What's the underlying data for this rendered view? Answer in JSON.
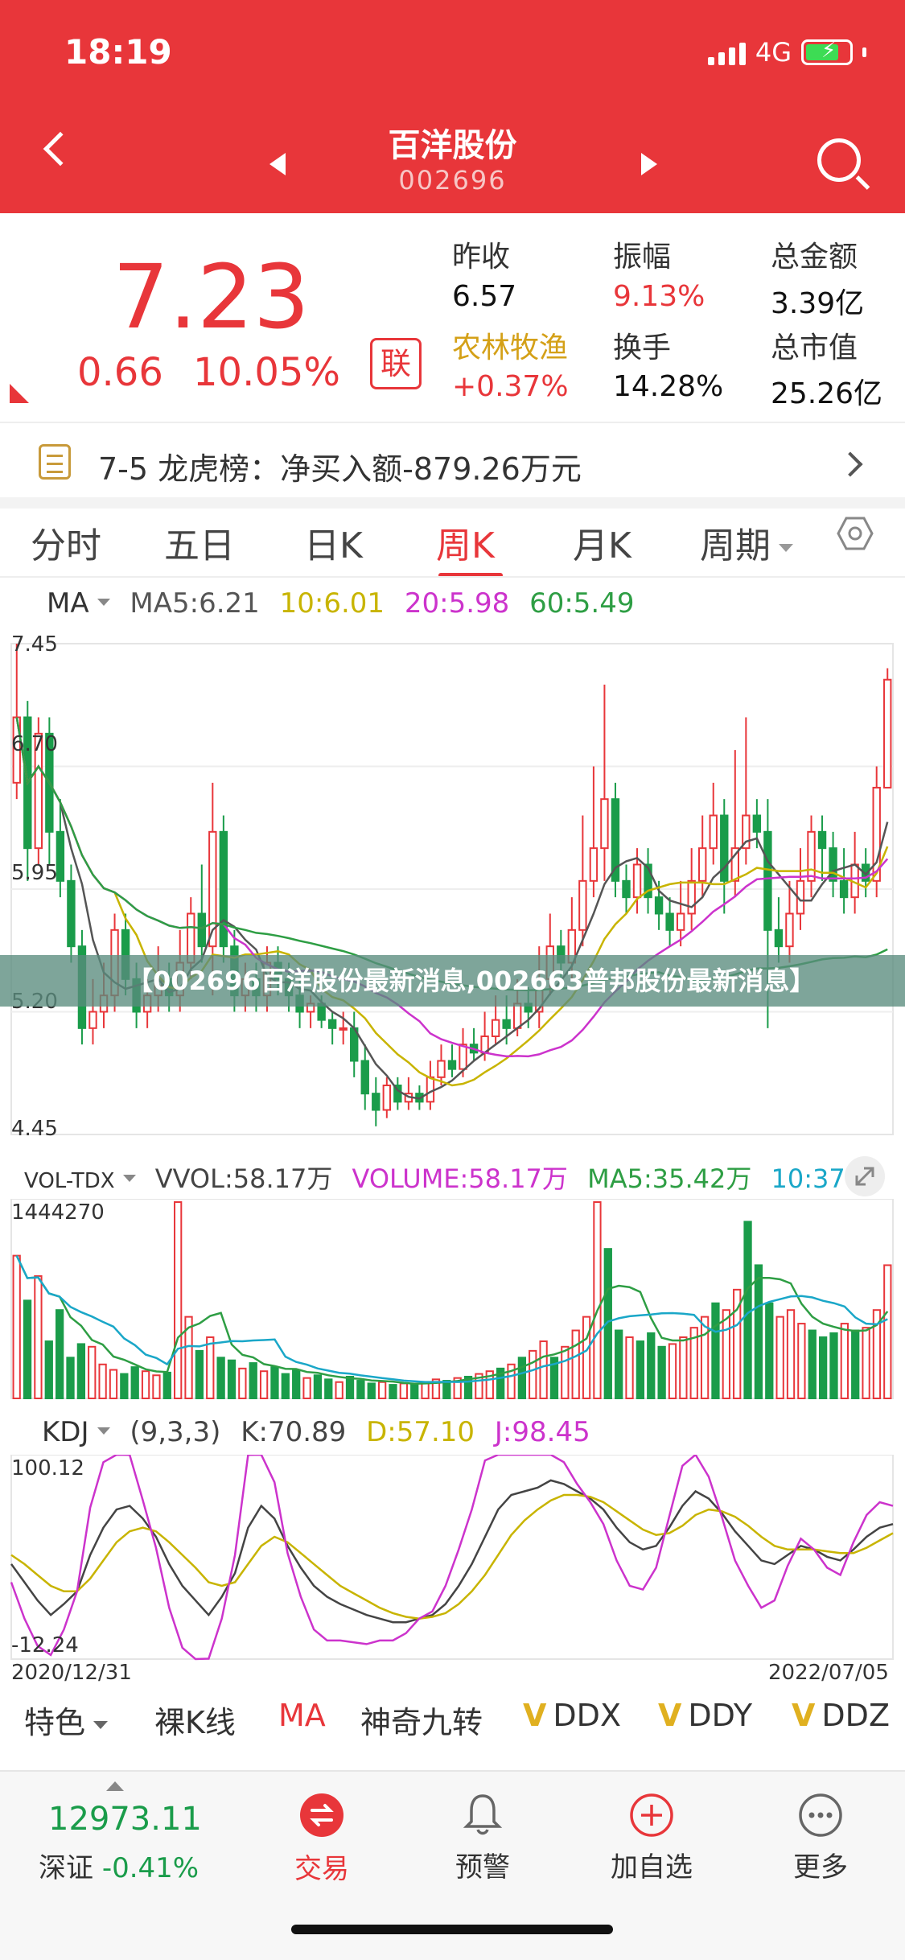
{
  "status": {
    "time": "18:19",
    "network": "4G"
  },
  "header": {
    "name": "百洋股份",
    "code": "002696"
  },
  "quote": {
    "price": "7.23",
    "change": "0.66",
    "change_pct": "10.05%",
    "badge": "联",
    "cells": [
      {
        "label": "昨收",
        "value": "6.57"
      },
      {
        "label": "振幅",
        "value": "9.13%"
      },
      {
        "label": "总金额",
        "value": "3.39亿"
      },
      {
        "label": "农林牧渔",
        "value": "+0.37%"
      },
      {
        "label": "换手",
        "value": "14.28%"
      },
      {
        "label": "总市值",
        "value": "25.26亿"
      }
    ]
  },
  "lhb": {
    "text": "7-5 龙虎榜：净买入额-879.26万元"
  },
  "tabs": [
    "分时",
    "五日",
    "日K",
    "周K",
    "月K",
    "周期"
  ],
  "active_tab": "周K",
  "ma_row": {
    "name": "MA",
    "ma5": "MA5:6.21",
    "ma10": "10:6.01",
    "ma20": "20:5.98",
    "ma60": "60:5.49"
  },
  "price_axis": {
    "top": "7.45",
    "l2": "6.70",
    "l3": "5.95",
    "l4": "5.20",
    "bottom": "4.45"
  },
  "vol_row": {
    "name": "VOL-TDX",
    "vvol": "VVOL:58.17万",
    "volume": "VOLUME:58.17万",
    "ma5": "MA5:35.42万",
    "ma10": "10:37..."
  },
  "vol_axis": {
    "top": "1444270"
  },
  "kdj_row": {
    "name": "KDJ",
    "params": "(9,3,3)",
    "k": "K:70.89",
    "d": "D:57.10",
    "j": "J:98.45"
  },
  "kdj_axis": {
    "top": "100.12",
    "bottom": "-12.24"
  },
  "date_range": {
    "start": "2020/12/31",
    "end": "2022/07/05"
  },
  "watermark": "【002696百洋股份最新消息,002663普邦股份最新消息】",
  "tools": {
    "special": "特色",
    "naked": "裸K线",
    "ma": "MA",
    "shenqi": "神奇九转",
    "ddx": "DDX",
    "ddy": "DDY",
    "ddz": "DDZ",
    "v": "V"
  },
  "tabbar": {
    "index_value": "12973.11",
    "index_name": "深证",
    "index_change": "-0.41%",
    "items": [
      "交易",
      "预警",
      "加自选",
      "更多"
    ]
  },
  "colors": {
    "brand_red": "#e8363a",
    "down_green": "#1a9c4a",
    "ma10": "#c8b400",
    "ma20": "#cc33cc",
    "ma60": "#2e9e44"
  },
  "chart_data": [
    {
      "type": "candlestick",
      "title": "",
      "period": "weekly",
      "ylim": [
        4.45,
        7.45
      ],
      "x_range": [
        "2020/12/31",
        "2022/07/05"
      ],
      "indicators": {
        "MA5": 6.21,
        "MA10": 6.01,
        "MA20": 5.98,
        "MA60": 5.49
      },
      "candles": [
        [
          6.6,
          7.0,
          7.45,
          6.5
        ],
        [
          7.0,
          6.2,
          7.1,
          6.0
        ],
        [
          6.2,
          6.9,
          7.0,
          6.1
        ],
        [
          6.9,
          6.3,
          7.0,
          6.1
        ],
        [
          6.3,
          6.0,
          6.5,
          5.9
        ],
        [
          6.0,
          5.6,
          6.1,
          5.5
        ],
        [
          5.6,
          5.1,
          5.7,
          5.0
        ],
        [
          5.1,
          5.2,
          5.4,
          5.0
        ],
        [
          5.2,
          5.3,
          5.5,
          5.1
        ],
        [
          5.3,
          5.7,
          5.8,
          5.2
        ],
        [
          5.7,
          5.4,
          5.8,
          5.3
        ],
        [
          5.4,
          5.2,
          5.5,
          5.1
        ],
        [
          5.2,
          5.3,
          5.4,
          5.1
        ],
        [
          5.3,
          5.4,
          5.6,
          5.2
        ],
        [
          5.4,
          5.3,
          5.5,
          5.2
        ],
        [
          5.3,
          5.5,
          5.7,
          5.2
        ],
        [
          5.5,
          5.8,
          5.9,
          5.4
        ],
        [
          5.8,
          5.6,
          6.1,
          5.5
        ],
        [
          5.6,
          6.3,
          6.6,
          5.3
        ],
        [
          6.3,
          5.6,
          6.4,
          5.5
        ],
        [
          5.6,
          5.3,
          5.7,
          5.2
        ],
        [
          5.3,
          5.4,
          5.5,
          5.2
        ],
        [
          5.4,
          5.3,
          5.5,
          5.2
        ],
        [
          5.3,
          5.5,
          5.6,
          5.2
        ],
        [
          5.5,
          5.4,
          5.6,
          5.3
        ],
        [
          5.4,
          5.3,
          5.5,
          5.2
        ],
        [
          5.3,
          5.2,
          5.4,
          5.1
        ],
        [
          5.2,
          5.25,
          5.3,
          5.1
        ],
        [
          5.25,
          5.15,
          5.3,
          5.1
        ],
        [
          5.15,
          5.1,
          5.2,
          5.0
        ],
        [
          5.1,
          5.1,
          5.2,
          5.0
        ],
        [
          5.1,
          4.9,
          5.2,
          4.8
        ],
        [
          4.9,
          4.7,
          5.0,
          4.6
        ],
        [
          4.7,
          4.6,
          4.8,
          4.5
        ],
        [
          4.6,
          4.75,
          4.8,
          4.55
        ],
        [
          4.75,
          4.65,
          4.8,
          4.6
        ],
        [
          4.65,
          4.7,
          4.8,
          4.6
        ],
        [
          4.7,
          4.65,
          4.75,
          4.6
        ],
        [
          4.65,
          4.8,
          4.9,
          4.6
        ],
        [
          4.8,
          4.9,
          5.0,
          4.75
        ],
        [
          4.9,
          4.85,
          5.0,
          4.8
        ],
        [
          4.85,
          5.0,
          5.1,
          4.8
        ],
        [
          5.0,
          4.95,
          5.1,
          4.9
        ],
        [
          4.95,
          5.05,
          5.2,
          4.9
        ],
        [
          5.05,
          5.15,
          5.3,
          5.0
        ],
        [
          5.15,
          5.1,
          5.3,
          5.0
        ],
        [
          5.1,
          5.25,
          5.4,
          5.05
        ],
        [
          5.25,
          5.2,
          5.35,
          5.1
        ],
        [
          5.2,
          5.4,
          5.6,
          5.1
        ],
        [
          5.4,
          5.6,
          5.8,
          5.3
        ],
        [
          5.6,
          5.5,
          5.7,
          5.4
        ],
        [
          5.5,
          5.7,
          5.9,
          5.4
        ],
        [
          5.7,
          6.0,
          6.4,
          5.6
        ],
        [
          6.0,
          6.2,
          6.7,
          5.9
        ],
        [
          6.2,
          6.5,
          7.2,
          6.0
        ],
        [
          6.5,
          6.0,
          6.6,
          5.9
        ],
        [
          6.0,
          5.9,
          6.1,
          5.8
        ],
        [
          5.9,
          6.1,
          6.2,
          5.8
        ],
        [
          6.1,
          5.9,
          6.2,
          5.8
        ],
        [
          5.9,
          5.8,
          6.0,
          5.7
        ],
        [
          5.8,
          5.7,
          5.9,
          5.6
        ],
        [
          5.7,
          5.8,
          6.0,
          5.6
        ],
        [
          5.8,
          6.0,
          6.2,
          5.7
        ],
        [
          6.0,
          6.2,
          6.4,
          5.9
        ],
        [
          6.2,
          6.4,
          6.6,
          6.1
        ],
        [
          6.4,
          6.0,
          6.5,
          5.8
        ],
        [
          6.0,
          6.2,
          6.8,
          5.9
        ],
        [
          6.2,
          6.4,
          7.0,
          6.1
        ],
        [
          6.4,
          6.3,
          6.5,
          6.2
        ],
        [
          6.3,
          5.7,
          6.5,
          5.1
        ],
        [
          5.7,
          5.6,
          5.9,
          5.5
        ],
        [
          5.6,
          5.8,
          6.0,
          5.5
        ],
        [
          5.8,
          6.0,
          6.2,
          5.7
        ],
        [
          6.0,
          6.3,
          6.4,
          5.9
        ],
        [
          6.3,
          6.2,
          6.4,
          6.0
        ],
        [
          6.2,
          6.0,
          6.3,
          5.9
        ],
        [
          6.0,
          5.9,
          6.2,
          5.8
        ],
        [
          5.9,
          6.1,
          6.3,
          5.8
        ],
        [
          6.1,
          6.0,
          6.2,
          5.9
        ],
        [
          6.0,
          6.57,
          6.7,
          5.9
        ],
        [
          6.57,
          7.23,
          7.3,
          6.57
        ]
      ]
    },
    {
      "type": "bar",
      "title": "",
      "ylim": [
        0,
        1444270
      ],
      "series": [
        {
          "name": "VVOL",
          "values": [
            1050000,
            720000,
            900000,
            420000,
            650000,
            300000,
            400000,
            380000,
            250000,
            210000,
            180000,
            230000,
            200000,
            170000,
            190000,
            1444270,
            600000,
            350000,
            450000,
            300000,
            280000,
            220000,
            260000,
            200000,
            230000,
            180000,
            210000,
            150000,
            170000,
            140000,
            120000,
            160000,
            130000,
            110000,
            120000,
            100000,
            110000,
            100000,
            120000,
            140000,
            130000,
            150000,
            160000,
            180000,
            200000,
            220000,
            250000,
            300000,
            350000,
            420000,
            300000,
            380000,
            500000,
            600000,
            1444270,
            1100000,
            500000,
            450000,
            420000,
            480000,
            380000,
            400000,
            450000,
            520000,
            600000,
            700000,
            650000,
            800000,
            1300000,
            980000,
            700000,
            600000,
            650000,
            550000,
            500000,
            450000,
            480000,
            550000,
            500000,
            520000,
            650000,
            980000
          ]
        }
      ]
    },
    {
      "type": "line",
      "title": "",
      "ylim": [
        -12.24,
        100.12
      ],
      "series": [
        {
          "name": "K",
          "values": [
            40,
            30,
            20,
            12,
            18,
            25,
            45,
            60,
            70,
            72,
            65,
            55,
            40,
            28,
            20,
            12,
            22,
            35,
            60,
            72,
            65,
            50,
            38,
            28,
            22,
            18,
            15,
            12,
            10,
            8,
            8,
            10,
            12,
            18,
            28,
            40,
            55,
            70,
            78,
            80,
            82,
            86,
            84,
            80,
            76,
            70,
            60,
            52,
            48,
            50,
            60,
            72,
            80,
            76,
            68,
            58,
            50,
            42,
            40,
            45,
            50,
            48,
            44,
            42,
            48,
            55,
            60,
            62
          ]
        },
        {
          "name": "D",
          "values": [
            45,
            40,
            34,
            28,
            25,
            25,
            32,
            42,
            52,
            58,
            60,
            58,
            52,
            45,
            38,
            30,
            28,
            30,
            40,
            50,
            55,
            52,
            46,
            40,
            34,
            28,
            24,
            20,
            16,
            13,
            11,
            10,
            11,
            13,
            18,
            25,
            34,
            45,
            56,
            64,
            70,
            75,
            78,
            78,
            77,
            74,
            69,
            64,
            59,
            56,
            57,
            61,
            67,
            70,
            69,
            66,
            61,
            55,
            50,
            48,
            48,
            48,
            47,
            46,
            46,
            49,
            53,
            57
          ]
        },
        {
          "name": "J",
          "values": [
            30,
            10,
            -5,
            -10,
            4,
            25,
            71,
            96,
            106,
            100,
            75,
            49,
            16,
            -6,
            -16,
            -12,
            10,
            45,
            100,
            116,
            85,
            46,
            22,
            4,
            -2,
            -2,
            -3,
            -4,
            -2,
            -2,
            2,
            10,
            14,
            28,
            48,
            70,
            97,
            120,
            122,
            112,
            106,
            108,
            96,
            84,
            74,
            62,
            42,
            28,
            26,
            38,
            66,
            94,
            106,
            88,
            66,
            42,
            28,
            16,
            20,
            39,
            54,
            48,
            38,
            34,
            52,
            67,
            74,
            72
          ]
        }
      ]
    }
  ]
}
